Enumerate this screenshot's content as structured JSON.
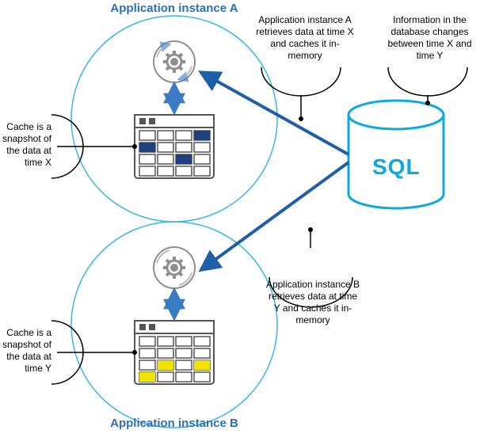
{
  "instanceA": {
    "title": "Application instance A",
    "cacheNote": "Cache is a snapshot of the data at time X",
    "retrieveNote": "Application instance A retrieves data at time X and caches it in-memory"
  },
  "instanceB": {
    "title": "Application instance B",
    "cacheNote": "Cache is a snapshot of the data at time Y",
    "retrieveNote": "Application instance B retrieves data at time Y and caches it in-memory"
  },
  "db": {
    "label": "SQL",
    "changeNote": "Information in the database changes between time X and time Y"
  },
  "colors": {
    "circle": "#39b7e8",
    "arrow": "#1f5fa8",
    "gear": "#8f8f8f",
    "tableStroke": "#555",
    "highlightA": "#1f3f7f",
    "highlightB": "#f2e200",
    "db": "#0aa9e0"
  }
}
